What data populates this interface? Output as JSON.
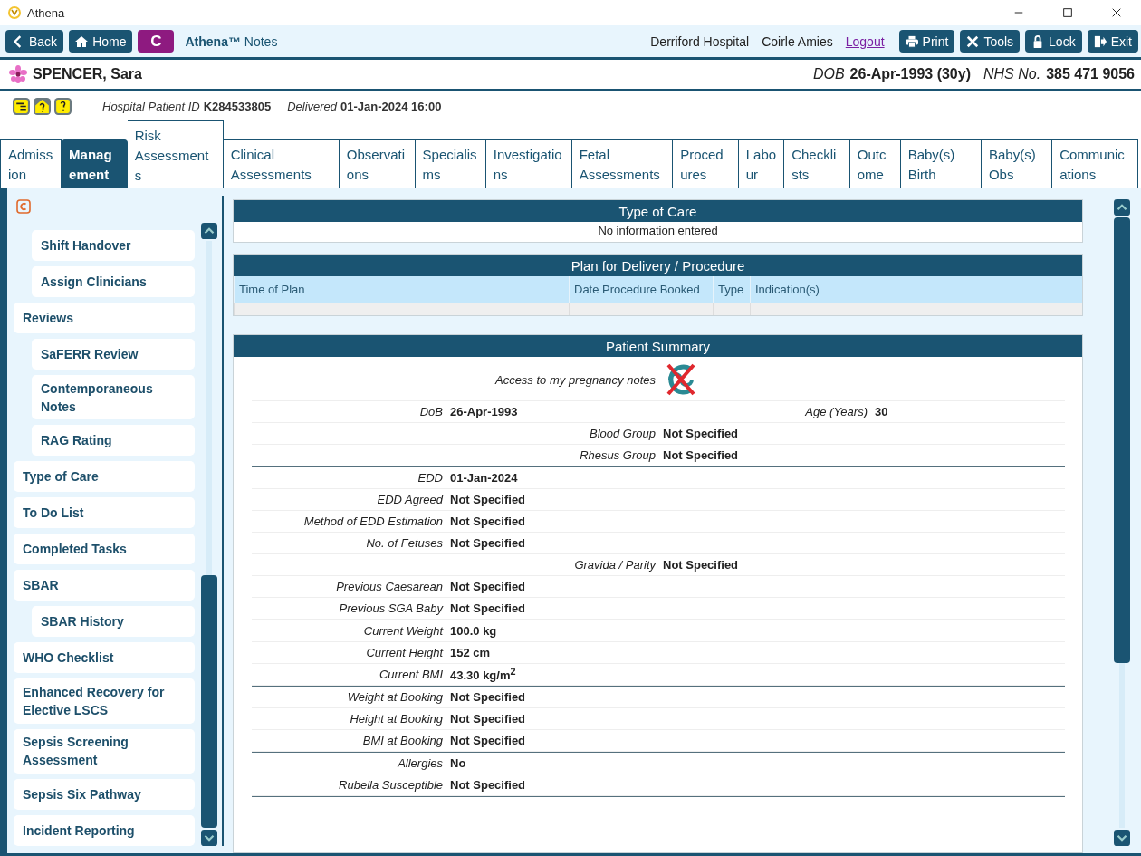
{
  "window": {
    "title": "Athena"
  },
  "toolbar": {
    "buttons": [
      {
        "label": "Back",
        "kind": "back"
      },
      {
        "label": "Home",
        "kind": "home"
      }
    ],
    "logo": "C",
    "app_name": "**Athena™** Notes",
    "hospital": "Derriford Hospital",
    "user": "Coirle Amies",
    "logout": "Logout",
    "actions": [
      {
        "label": "Print",
        "kind": "print"
      },
      {
        "label": "Tools",
        "kind": "tools"
      },
      {
        "label": "Lock",
        "kind": "lock"
      },
      {
        "label": "Exit",
        "kind": "exit"
      }
    ]
  },
  "patient": {
    "name": "SPENCER, Sara",
    "dob_label": "DOB",
    "dob": "26-Apr-1993 (30y)",
    "nhs_label": "NHS No.",
    "nhs": "385 471 9056",
    "hospital_id_label": "Hospital Patient ID",
    "hospital_id": "K284533805",
    "delivered_label": "Delivered",
    "delivered": "01-Jan-2024 16:00"
  },
  "tabs": [
    {
      "label": "Admission",
      "selected": false
    },
    {
      "label": "Management",
      "selected": true
    },
    {
      "label": "Risk Assessments",
      "selected": false,
      "raised": true
    },
    {
      "label": "Clinical Assessments",
      "selected": false
    },
    {
      "label": "Observations",
      "selected": false
    },
    {
      "label": "Specialisms",
      "selected": false
    },
    {
      "label": "Investigations",
      "selected": false
    },
    {
      "label": "Fetal Assessments",
      "selected": false
    },
    {
      "label": "Procedures",
      "selected": false
    },
    {
      "label": "Labour",
      "selected": false
    },
    {
      "label": "Checklists",
      "selected": false
    },
    {
      "label": "Outcome",
      "selected": false
    },
    {
      "label": "Baby(s) Birth",
      "selected": false
    },
    {
      "label": "Baby(s) Obs",
      "selected": false
    },
    {
      "label": "Communications",
      "selected": false
    }
  ],
  "sidebar": {
    "items": [
      {
        "children": [
          {
            "label": "Shift Handover"
          },
          {
            "label": "Assign Clinicians"
          }
        ]
      },
      {
        "label": "Reviews",
        "children": [
          {
            "label": "SaFERR Review"
          },
          {
            "label": "Contemporaneous Notes"
          },
          {
            "label": "RAG Rating"
          }
        ]
      },
      {
        "label": "Type of Care"
      },
      {
        "label": "To Do List"
      },
      {
        "label": "Completed Tasks"
      },
      {
        "label": "SBAR",
        "children": [
          {
            "label": "SBAR History"
          }
        ]
      },
      {
        "label": "WHO Checklist"
      },
      {
        "label": "Enhanced Recovery for Elective LSCS"
      },
      {
        "label": "Sepsis Screening Assessment"
      },
      {
        "label": "Sepsis Six Pathway"
      },
      {
        "label": "Incident Reporting"
      }
    ]
  },
  "type_of_care": {
    "title": "Type of Care",
    "message": "No information entered"
  },
  "plan": {
    "title": "Plan for Delivery / Procedure",
    "columns": [
      "Time of Plan",
      "Date Procedure Booked",
      "Type",
      "Indication(s)"
    ]
  },
  "summary": {
    "title": "Patient Summary",
    "groups": [
      [
        {
          "sub": {
            "label": "Access to my pregnancy notes",
            "kind": "access",
            "enabled": false
          }
        },
        {
          "main": {
            "label": "DoB",
            "value": "26-Apr-1993"
          },
          "aside": {
            "label": "Age (Years)",
            "value": "30"
          }
        },
        {
          "sub": {
            "label": "Blood Group",
            "value": "Not Specified"
          }
        },
        {
          "sub": {
            "label": "Rhesus Group",
            "value": "Not Specified"
          }
        }
      ],
      [
        {
          "main": {
            "label": "EDD",
            "value": "01-Jan-2024"
          }
        },
        {
          "main": {
            "label": "EDD Agreed",
            "value": "Not Specified"
          }
        },
        {
          "main": {
            "label": "Method of EDD Estimation",
            "value": "Not Specified"
          }
        },
        {
          "main": {
            "label": "No. of Fetuses",
            "value": "Not Specified"
          }
        },
        {
          "sub": {
            "label": "Gravida / Parity",
            "value": "Not Specified"
          }
        },
        {
          "main": {
            "label": "Previous Caesarean",
            "value": "Not Specified"
          }
        },
        {
          "main": {
            "label": "Previous SGA Baby",
            "value": "Not Specified"
          }
        }
      ],
      [
        {
          "main": {
            "label": "Current Weight",
            "value": "100.0 kg"
          }
        },
        {
          "main": {
            "label": "Current Height",
            "value": "152 cm"
          }
        },
        {
          "main": {
            "label": "Current BMI",
            "value": "43.30 kg/m$^{2}$"
          }
        }
      ],
      [
        {
          "main": {
            "label": "Weight at Booking",
            "value": "Not Specified"
          }
        },
        {
          "main": {
            "label": "Height at Booking",
            "value": "Not Specified"
          }
        },
        {
          "main": {
            "label": "BMI at Booking",
            "value": "Not Specified"
          }
        }
      ],
      [
        {
          "main": {
            "label": "Allergies",
            "value": "No"
          }
        },
        {
          "main": {
            "label": "Rubella Susceptible",
            "value": "Not Specified"
          }
        }
      ]
    ]
  }
}
